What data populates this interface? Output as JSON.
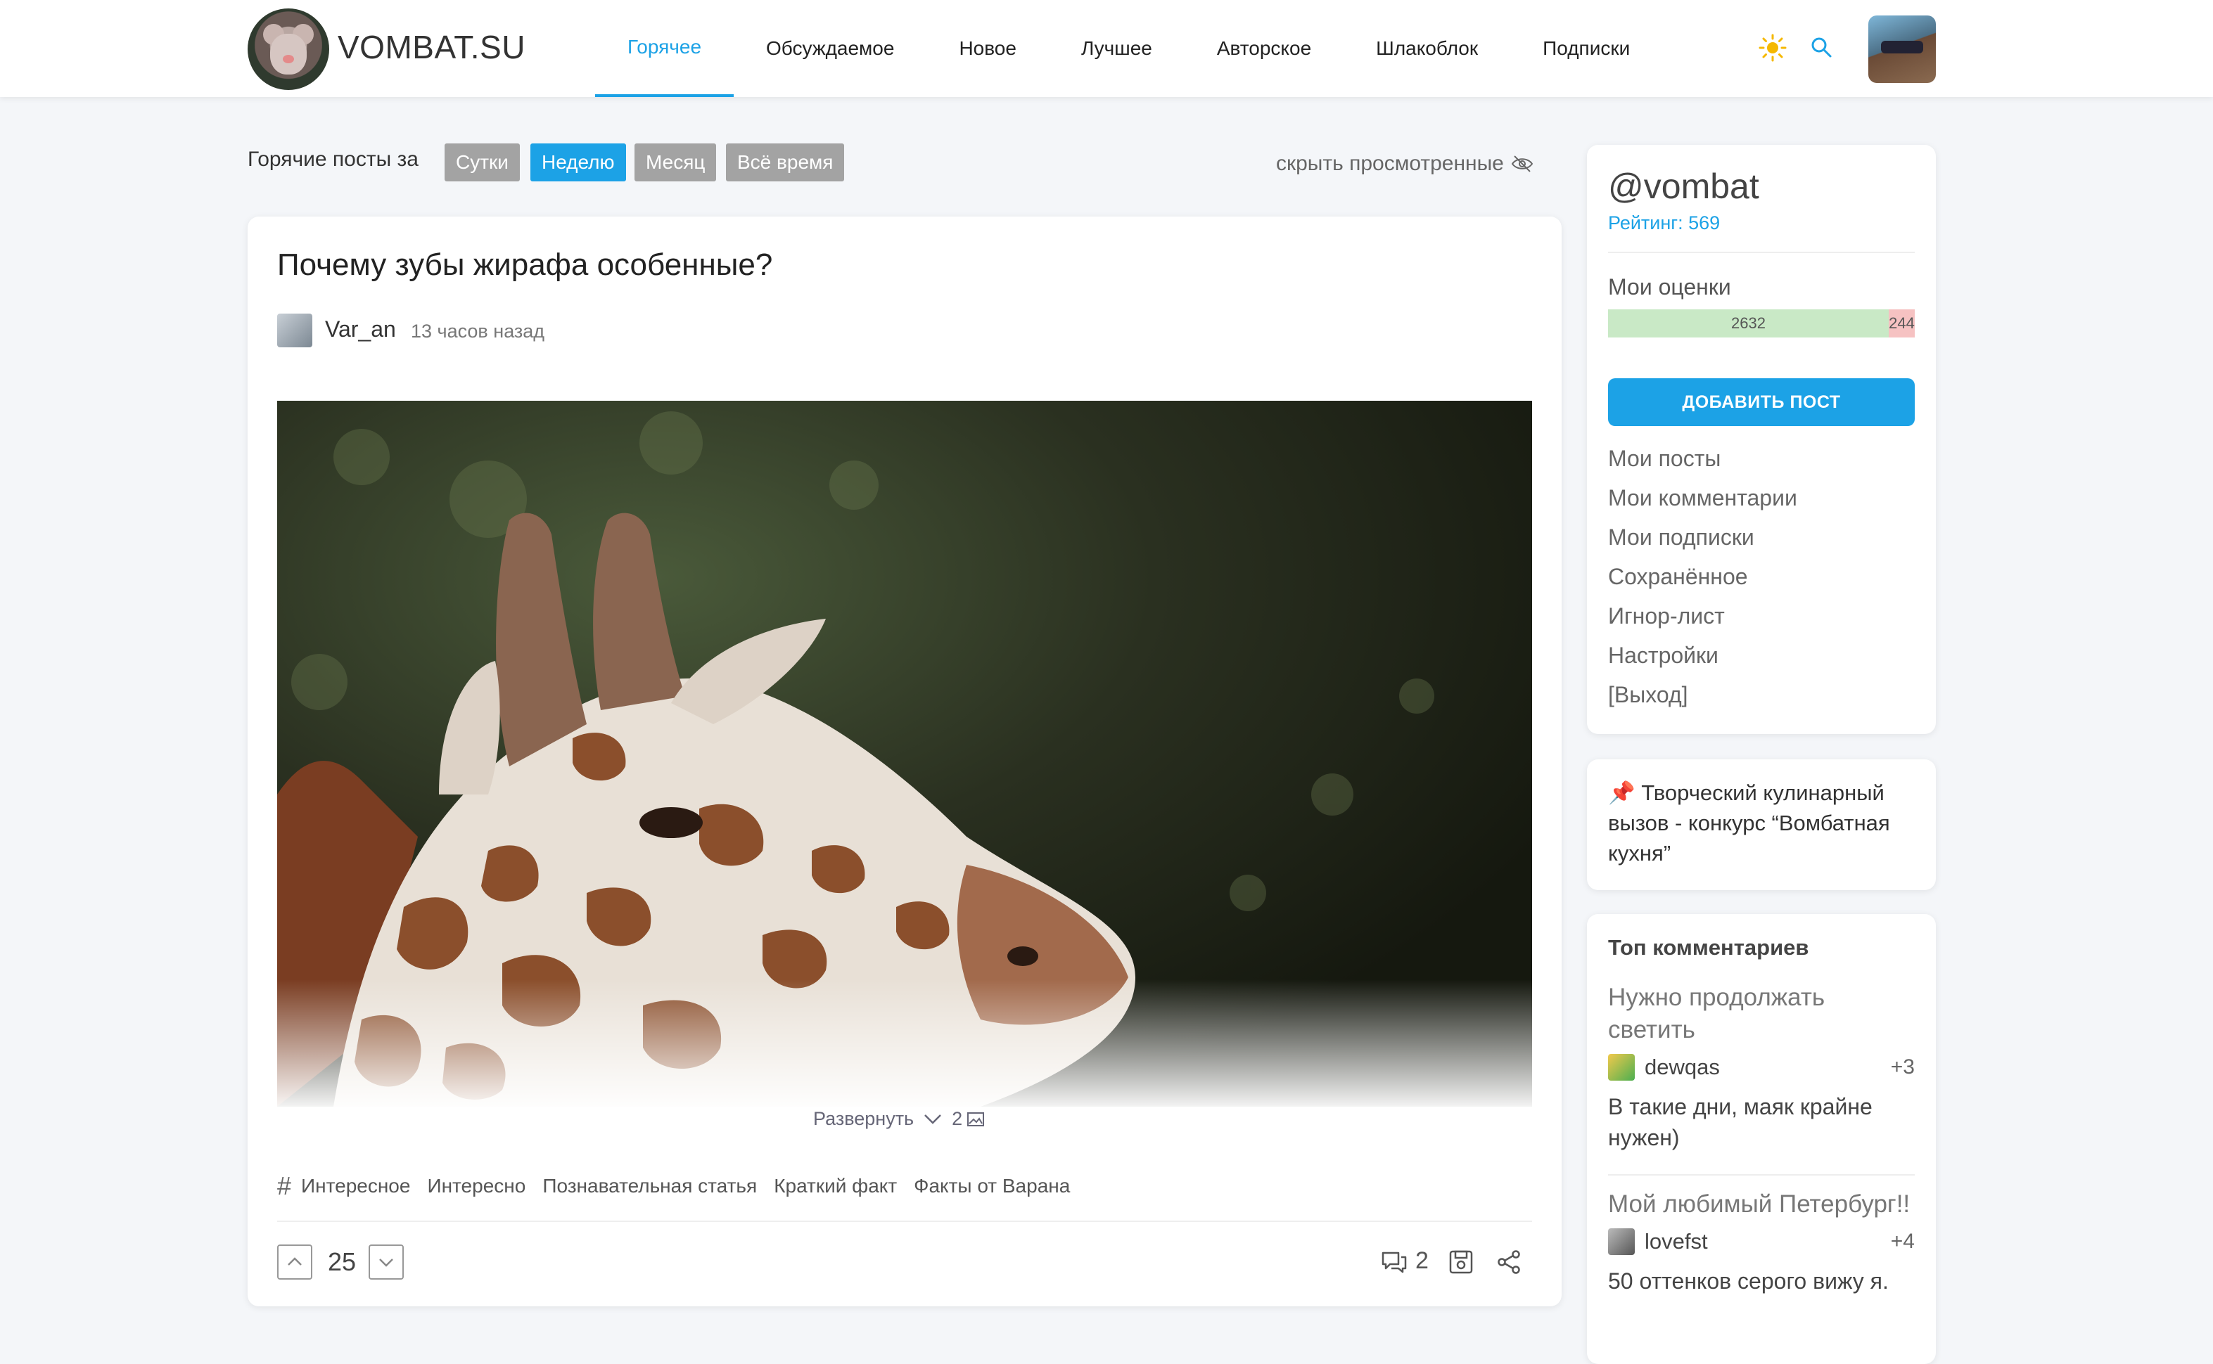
{
  "header": {
    "brand": "VOMBAT.SU",
    "nav": [
      "Горячее",
      "Обсуждаемое",
      "Новое",
      "Лучшее",
      "Авторское",
      "Шлакоблок",
      "Подписки"
    ],
    "active_nav": "Горячее",
    "accent_color": "#1ca2e6"
  },
  "filter": {
    "label": "Горячие посты за",
    "periods": [
      "Сутки",
      "Неделю",
      "Месяц",
      "Всё время"
    ],
    "active_period": "Неделю",
    "hide_viewed": "скрыть просмотренные"
  },
  "post": {
    "title": "Почему зубы жирафа особенные?",
    "author": "Var_an",
    "time": "13 часов назад",
    "expand_label": "Развернуть",
    "image_count": "2",
    "tags": [
      "Интересное",
      "Интересно",
      "Познавательная статья",
      "Краткий факт",
      "Факты от Варана"
    ],
    "rating": "25",
    "comments": "2"
  },
  "sidebar": {
    "username": "@vombat",
    "rating_label": "Рейтинг: 569",
    "votes_label": "Мои оценки",
    "votes_positive": "2632",
    "votes_negative": "244",
    "add_post": "ДОБАВИТЬ ПОСТ",
    "menu": [
      "Мои посты",
      "Мои комментарии",
      "Мои подписки",
      "Сохранённое",
      "Игнор-лист",
      "Настройки",
      "[Выход]"
    ],
    "pinned": "📌 Творческий кулинарный вызов - конкурс “Вомбатная кухня”",
    "top_comments_title": "Топ комментариев",
    "top_comments": [
      {
        "post": "Нужно продолжать светить",
        "user": "dewqas",
        "score": "+3",
        "text": "В такие дни, маяк крайне нужен)"
      },
      {
        "post": "Мой любимый Петербург!!",
        "user": "lovefst",
        "score": "+4",
        "text": "50 оттенков серого вижу я."
      }
    ]
  }
}
